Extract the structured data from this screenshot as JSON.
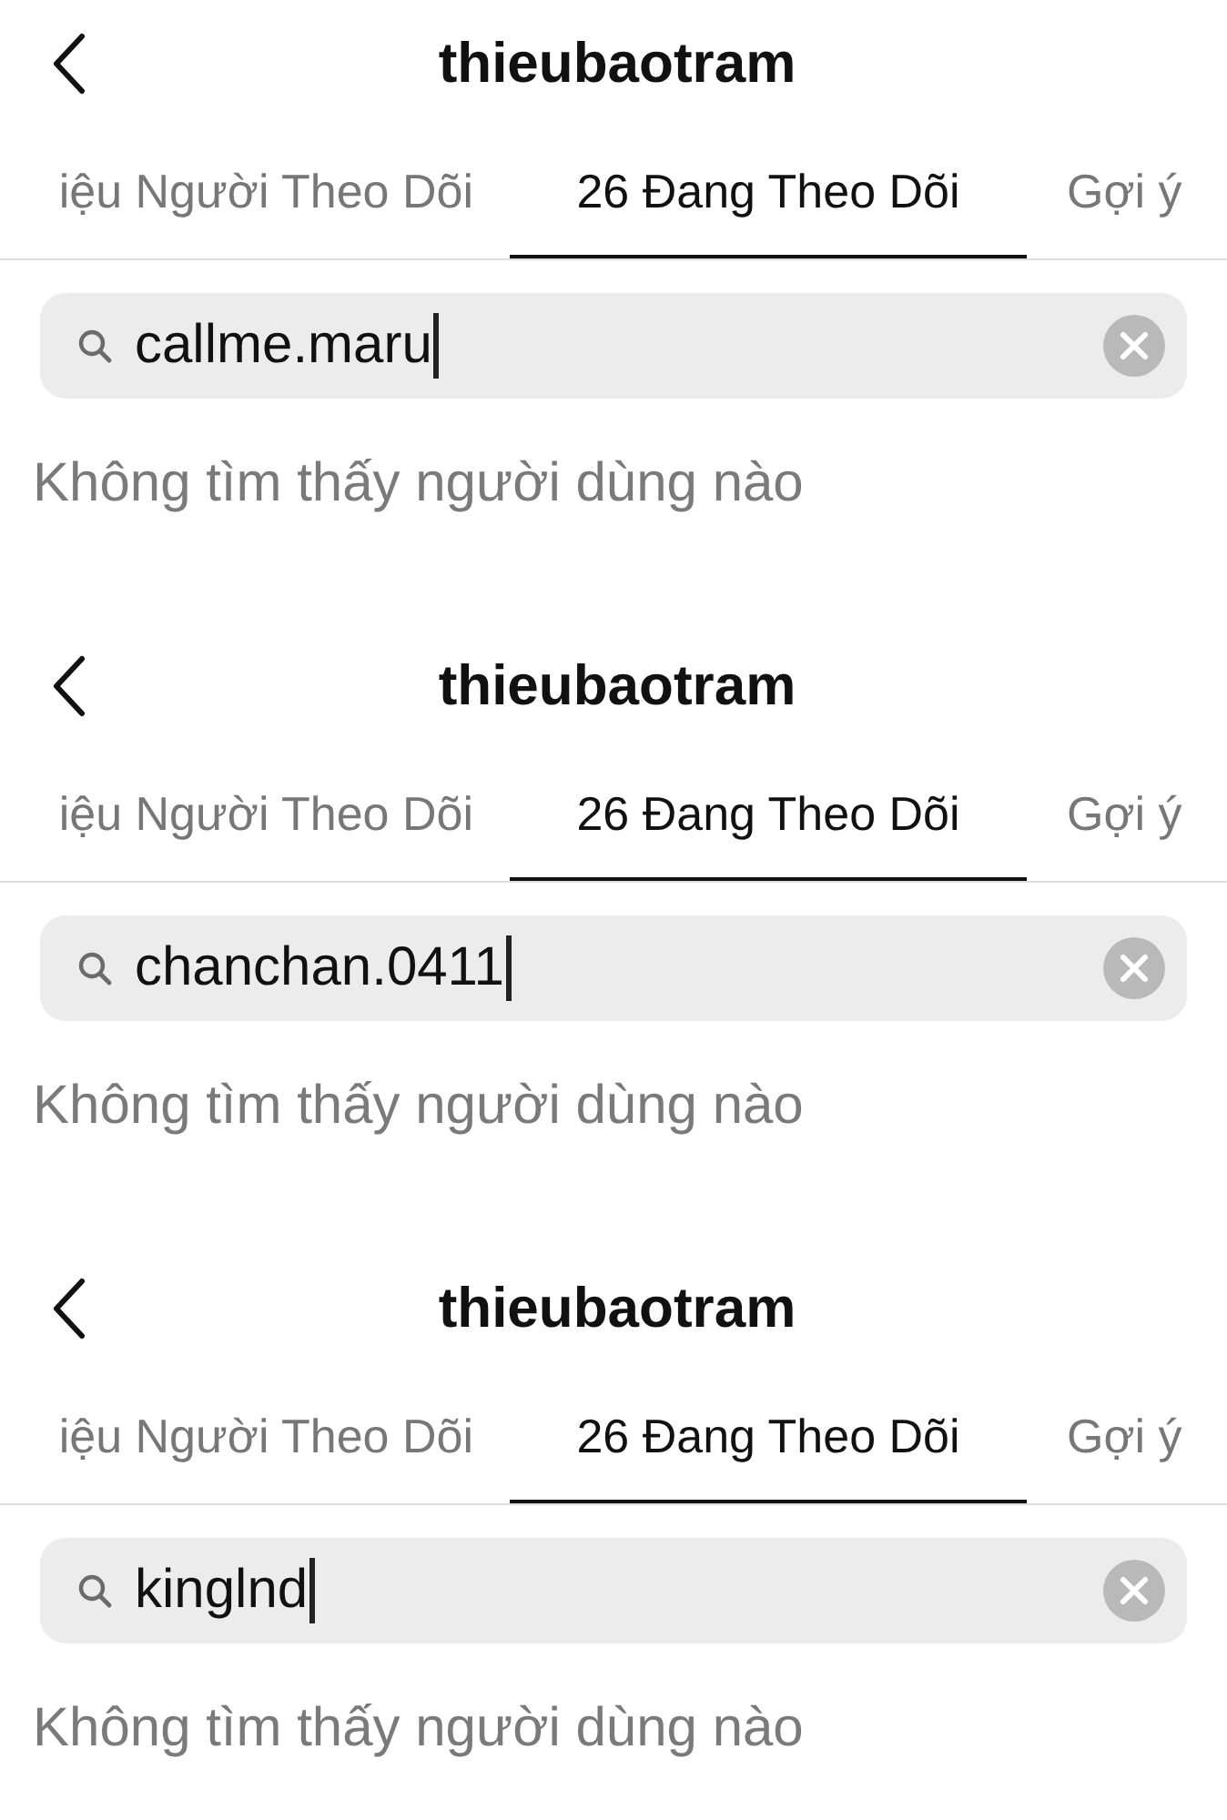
{
  "panels": [
    {
      "title": "thieubaotram",
      "tabs": [
        {
          "label": "iệu Người Theo Dõi",
          "selected": false
        },
        {
          "label": "26 Đang Theo Dõi",
          "selected": true
        },
        {
          "label": "Gợi ý",
          "selected": false
        }
      ],
      "search": {
        "value": "callme.maru"
      },
      "message": "Không tìm thấy người dùng nào"
    },
    {
      "title": "thieubaotram",
      "tabs": [
        {
          "label": "iệu Người Theo Dõi",
          "selected": false
        },
        {
          "label": "26 Đang Theo Dõi",
          "selected": true
        },
        {
          "label": "Gợi ý",
          "selected": false
        }
      ],
      "search": {
        "value": "chanchan.0411"
      },
      "message": "Không tìm thấy người dùng nào"
    },
    {
      "title": "thieubaotram",
      "tabs": [
        {
          "label": "iệu Người Theo Dõi",
          "selected": false
        },
        {
          "label": "26 Đang Theo Dõi",
          "selected": true
        },
        {
          "label": "Gợi ý",
          "selected": false
        }
      ],
      "search": {
        "value": "kinglnd"
      },
      "message": "Không tìm thấy người dùng nào"
    }
  ]
}
